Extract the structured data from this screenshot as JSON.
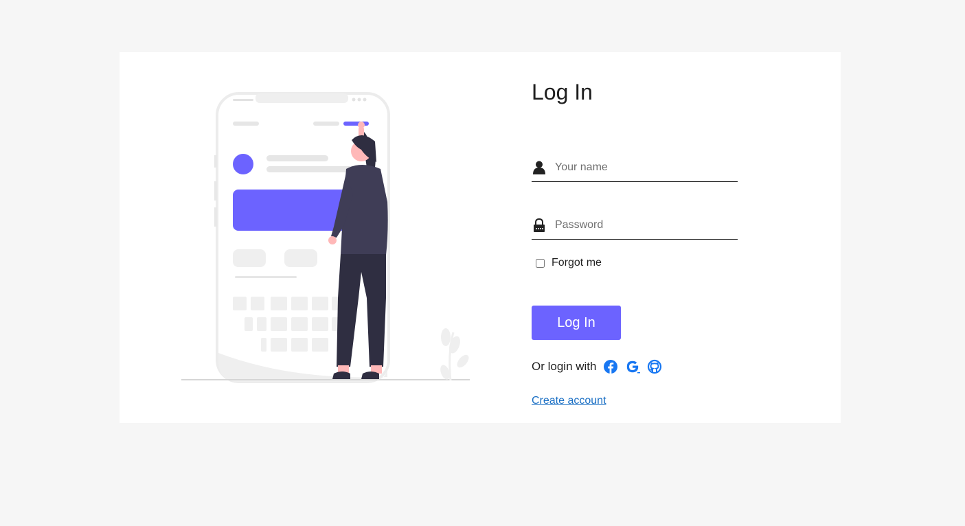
{
  "login": {
    "title": "Log In",
    "name_placeholder": "Your name",
    "password_placeholder": "Password",
    "remember_label": "Forgot me",
    "submit_label": "Log In",
    "social_label": "Or login with",
    "social_icons": [
      "facebook-icon",
      "google-icon",
      "github-icon"
    ],
    "create_account_label": "Create account"
  },
  "colors": {
    "page_background": "#f6f6f6",
    "card_background": "#ffffff",
    "accent": "#6c63ff",
    "link": "#1a6fc4",
    "social_icon": "#1877f2"
  }
}
